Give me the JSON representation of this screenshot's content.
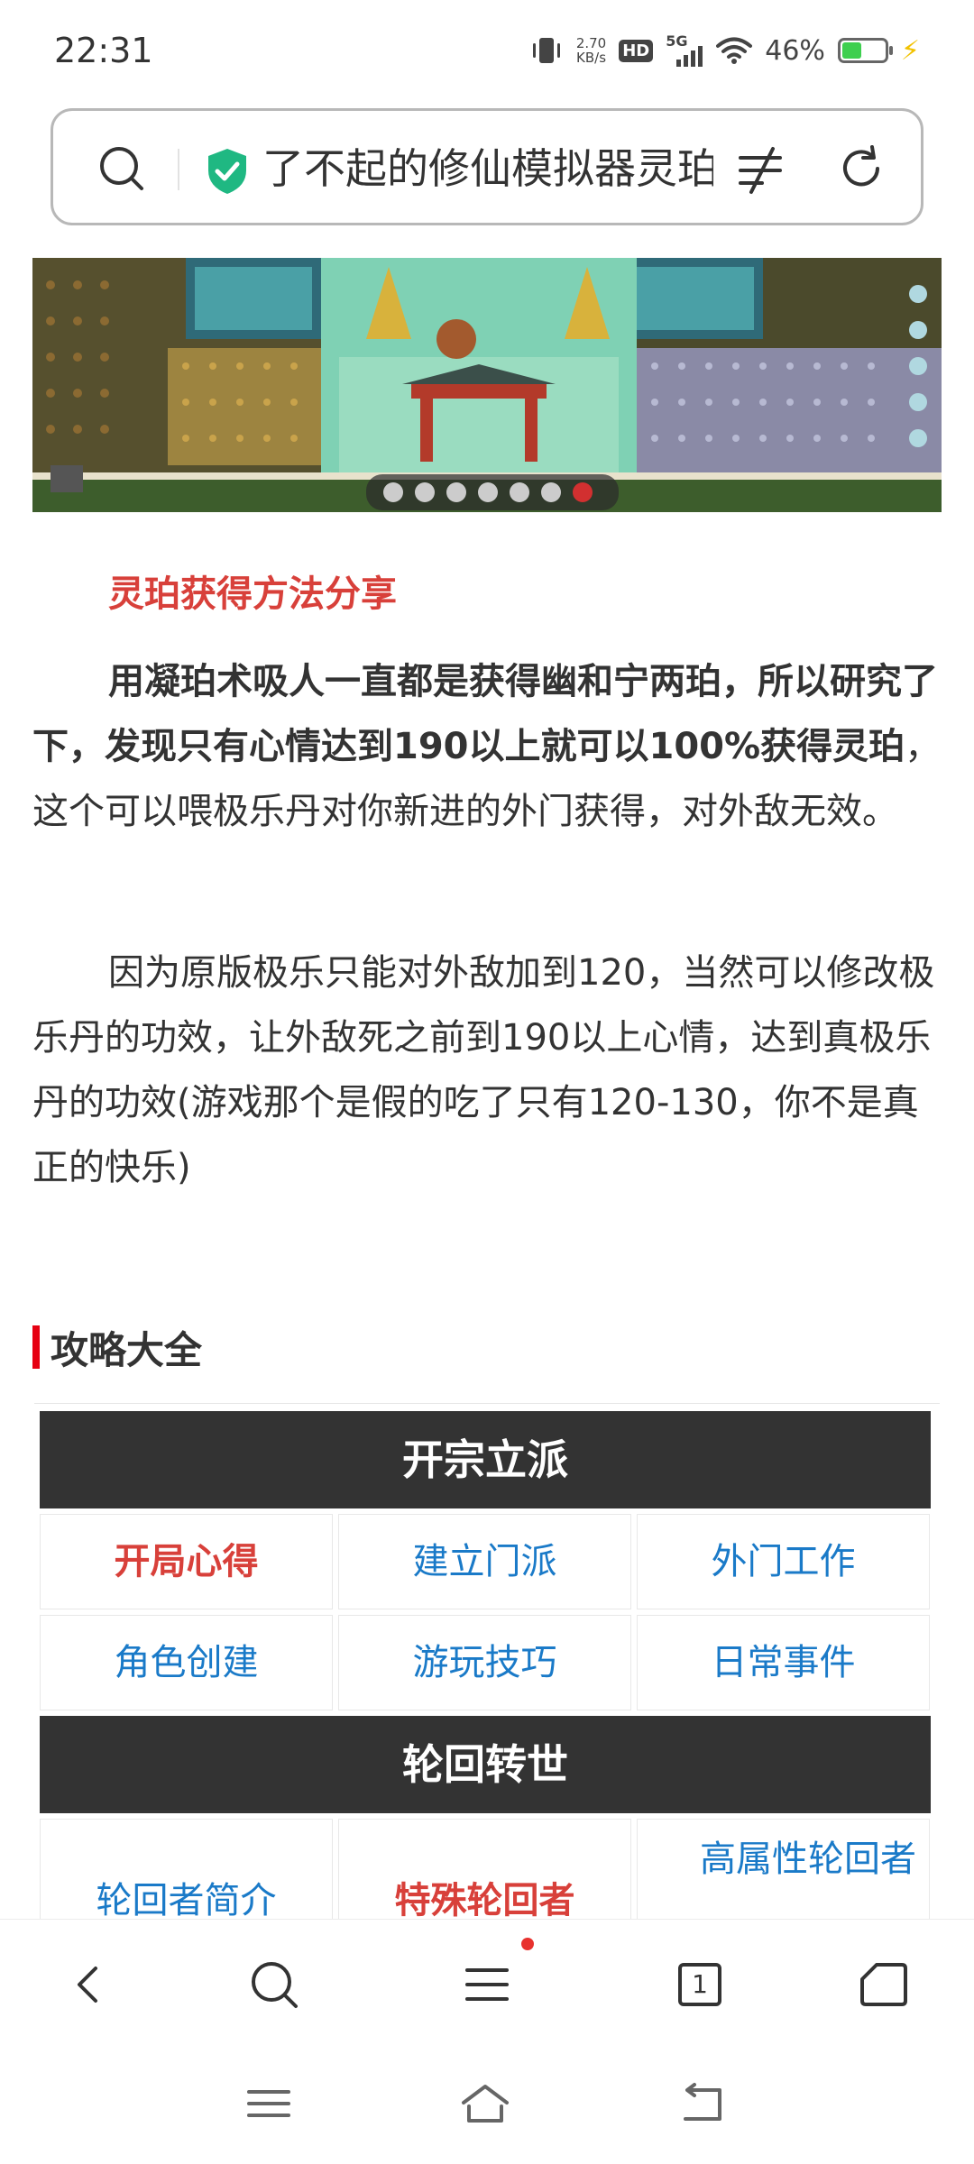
{
  "status": {
    "time": "22:31",
    "net_speed_value": "2.70",
    "net_speed_unit": "KB/s",
    "hd_label": "HD",
    "network_label": "5G",
    "battery_percent": "46%",
    "battery_level": 0.46
  },
  "address_bar": {
    "title": "了不起的修仙模拟器灵珀"
  },
  "article": {
    "subtitle": "灵珀获得方法分享",
    "para1_bold": "用凝珀术吸人一直都是获得幽和宁两珀，所以研究了下，发现只有心情达到190以上就可以100%获得灵珀",
    "para1_rest": "，这个可以喂极乐丹对你新进的外门获得，对外敌无效。",
    "para2": "因为原版极乐只能对外敌加到120，当然可以修改极乐丹的功效，让外敌死之前到190以上心情，达到真极乐丹的功效(游戏那个是假的吃了只有120-130，你不是真正的快乐)"
  },
  "guide": {
    "heading": "攻略大全",
    "section1": {
      "title": "开宗立派",
      "links": [
        "开局心得",
        "建立门派",
        "外门工作",
        "角色创建",
        "游玩技巧",
        "日常事件"
      ]
    },
    "section2": {
      "title": "轮回转世",
      "links": [
        "轮回者简介",
        "特殊轮回者",
        "高属性轮回者"
      ]
    }
  },
  "bottom_nav": {
    "tab_count": "1"
  },
  "icons": [
    "search-icon",
    "shield-check-icon",
    "filter-icon",
    "reload-icon",
    "back-icon",
    "menu-icon",
    "tabs-icon",
    "home-icon",
    "recents-icon",
    "sys-home-icon",
    "sys-back-icon"
  ],
  "colors": {
    "accent_red": "#d8403a",
    "link_blue": "#1a7ac8",
    "header_dark": "#333333",
    "shield_green": "#1fb882"
  }
}
